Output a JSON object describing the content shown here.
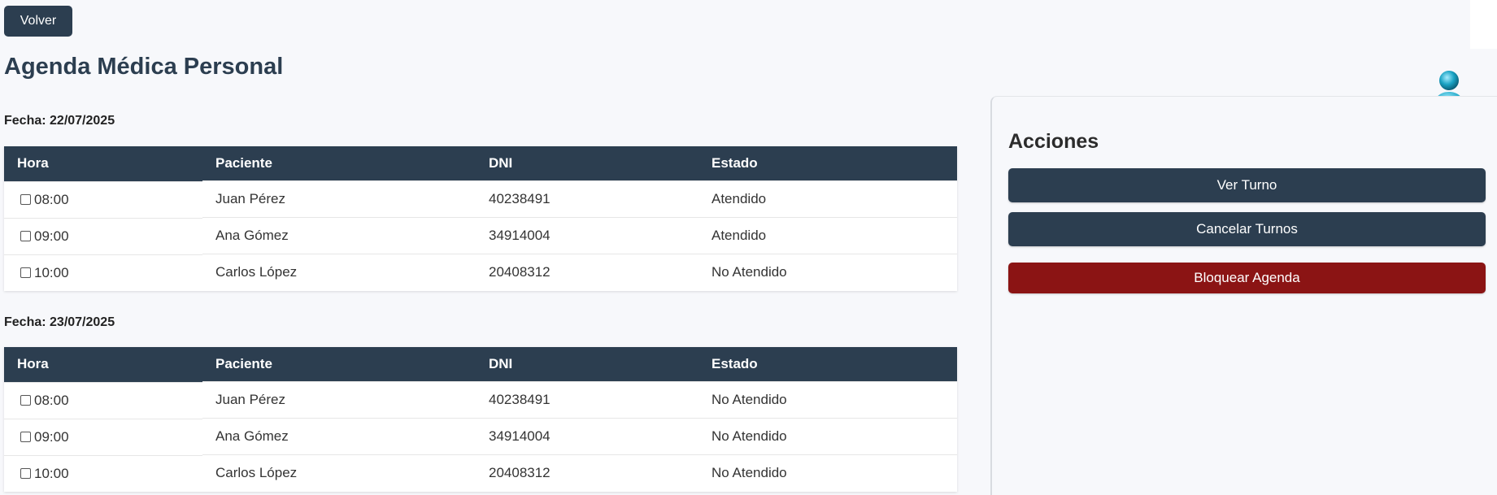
{
  "header": {
    "back_label": "Volver",
    "title": "Agenda Médica Personal"
  },
  "columns": [
    "Hora",
    "Paciente",
    "DNI",
    "Estado"
  ],
  "days": [
    {
      "date_label": "Fecha: 22/07/2025",
      "rows": [
        {
          "hora": "08:00",
          "paciente": "Juan Pérez",
          "dni": "40238491",
          "estado": "Atendido"
        },
        {
          "hora": "09:00",
          "paciente": "Ana Gómez",
          "dni": "34914004",
          "estado": "Atendido"
        },
        {
          "hora": "10:00",
          "paciente": "Carlos López",
          "dni": "20408312",
          "estado": "No Atendido"
        }
      ]
    },
    {
      "date_label": "Fecha: 23/07/2025",
      "rows": [
        {
          "hora": "08:00",
          "paciente": "Juan Pérez",
          "dni": "40238491",
          "estado": "No Atendido"
        },
        {
          "hora": "09:00",
          "paciente": "Ana Gómez",
          "dni": "34914004",
          "estado": "No Atendido"
        },
        {
          "hora": "10:00",
          "paciente": "Carlos López",
          "dni": "20408312",
          "estado": "No Atendido"
        }
      ]
    }
  ],
  "sidebar": {
    "title": "Acciones",
    "ver_turno": "Ver Turno",
    "cancelar_turnos": "Cancelar Turnos",
    "bloquear_agenda": "Bloquear Agenda"
  },
  "colors": {
    "primary": "#2c3e50",
    "danger": "#8b1414",
    "avatar": "#1aa3c4"
  },
  "icons": {
    "avatar": "user-avatar-icon"
  }
}
